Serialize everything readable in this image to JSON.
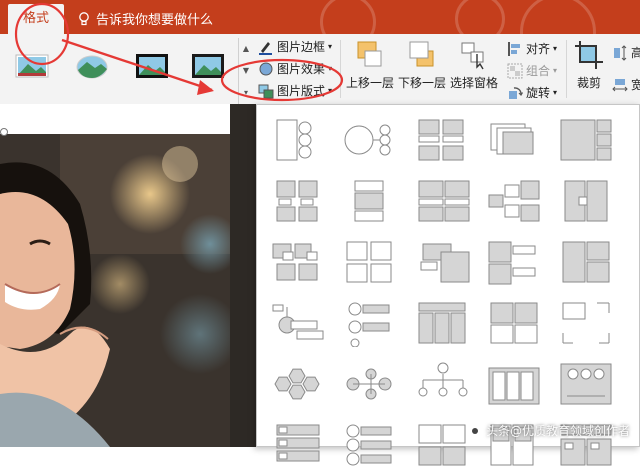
{
  "ribbon": {
    "active_tab": "格式",
    "tell_me": "告诉我你想要做什么",
    "picture_border": "图片边框",
    "picture_effects": "图片效果",
    "picture_layout": "图片版式",
    "bring_forward": "上移一层",
    "send_backward": "下移一层",
    "selection_pane": "选择窗格",
    "align": "对齐",
    "group": "组合",
    "rotate": "旋转",
    "crop": "裁剪",
    "height": "高",
    "width": "宽"
  },
  "colors": {
    "ribbon_red": "#c43e1c",
    "annotation_red": "#e53935",
    "layout_gray": "#d5d5d5",
    "layout_stroke": "#8a8a8a"
  },
  "layout_gallery": {
    "rows": 6,
    "columns": 5,
    "icons": [
      "bending-picture-accent-list",
      "circle-picture-hierarchy",
      "picture-caption-grid",
      "snapshot-picture-list",
      "picture-grid",
      "bending-picture-caption",
      "title-picture-blocks",
      "framed-text-picture",
      "picture-accent-blocks",
      "picture-strips",
      "bending-picture-semi-transparent",
      "picture-frame",
      "picture-accent-process",
      "captioned-pictures",
      "picture-lineup",
      "accent-picture",
      "circle-picture-process",
      "picture-columns",
      "title-picture-lineup",
      "picture-fill-blocks",
      "hexagon-cluster",
      "circle-radial",
      "picture-organization-chart",
      "ascending-picture-columns",
      "horizontal-picture-list",
      "picture-caption-list",
      "accent-circle-list",
      "picture-title-blocks",
      "framed-picture-list",
      "picture-block-list"
    ]
  },
  "watermark": "头条@优质教育领域创作者"
}
